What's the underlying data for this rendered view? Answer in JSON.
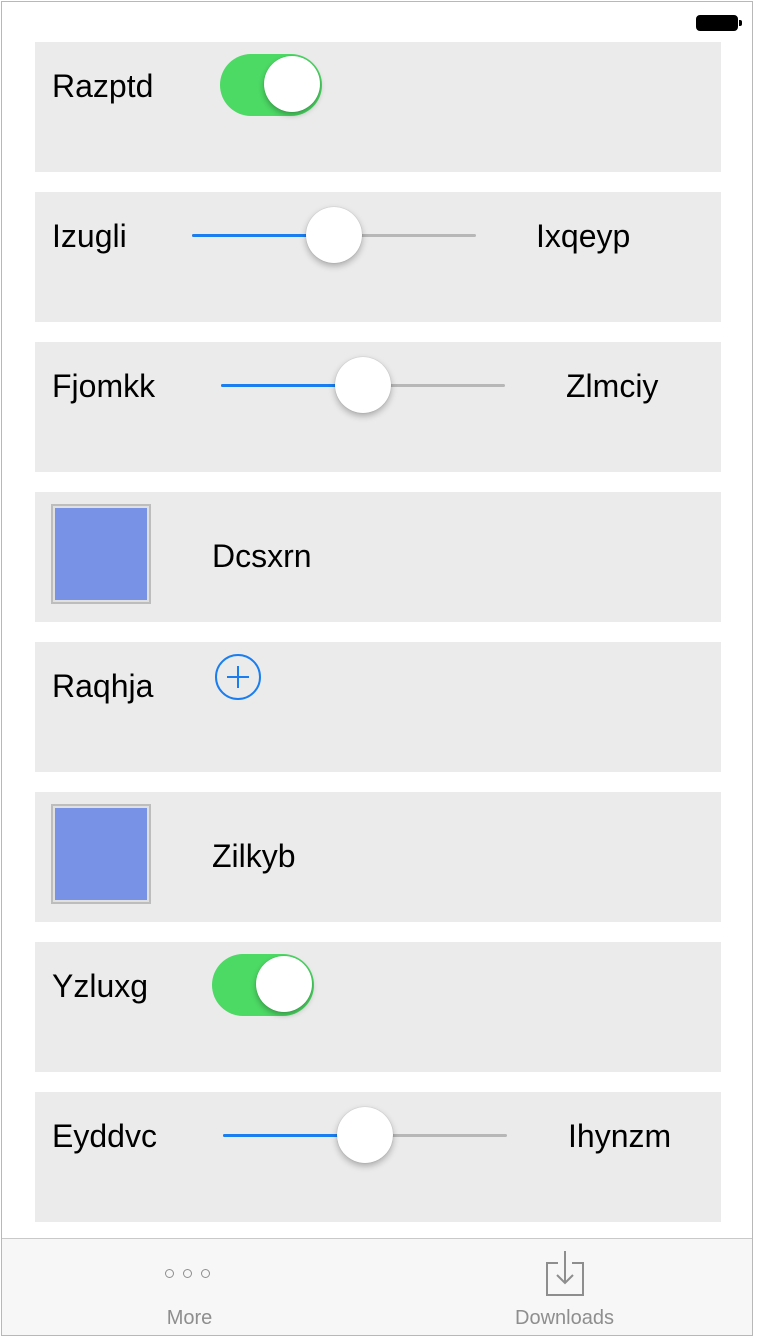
{
  "cells": [
    {
      "kind": "toggle",
      "label": "Razptd",
      "on": true
    },
    {
      "kind": "slider",
      "label": "Izugli",
      "value": 0.5,
      "right_label": "Ixqeyp"
    },
    {
      "kind": "slider",
      "label": "Fjomkk",
      "value": 0.5,
      "right_label": "Zlmciy"
    },
    {
      "kind": "swatch",
      "label": "Dcsxrn",
      "color": "#7893e6"
    },
    {
      "kind": "add",
      "label": "Raqhja"
    },
    {
      "kind": "swatch",
      "label": "Zilkyb",
      "color": "#7893e6"
    },
    {
      "kind": "toggle",
      "label": "Yzluxg",
      "on": true
    },
    {
      "kind": "slider",
      "label": "Eyddvc",
      "value": 0.5,
      "right_label": "Ihynzm"
    }
  ],
  "tab_bar": {
    "tabs": [
      {
        "label": "More",
        "icon": "more-icon"
      },
      {
        "label": "Downloads",
        "icon": "downloads-icon"
      }
    ]
  },
  "colors": {
    "toggle_on": "#4cd964",
    "accent": "#1a7ef0",
    "cell_background": "#ebebeb",
    "swatch": "#7893e6"
  }
}
